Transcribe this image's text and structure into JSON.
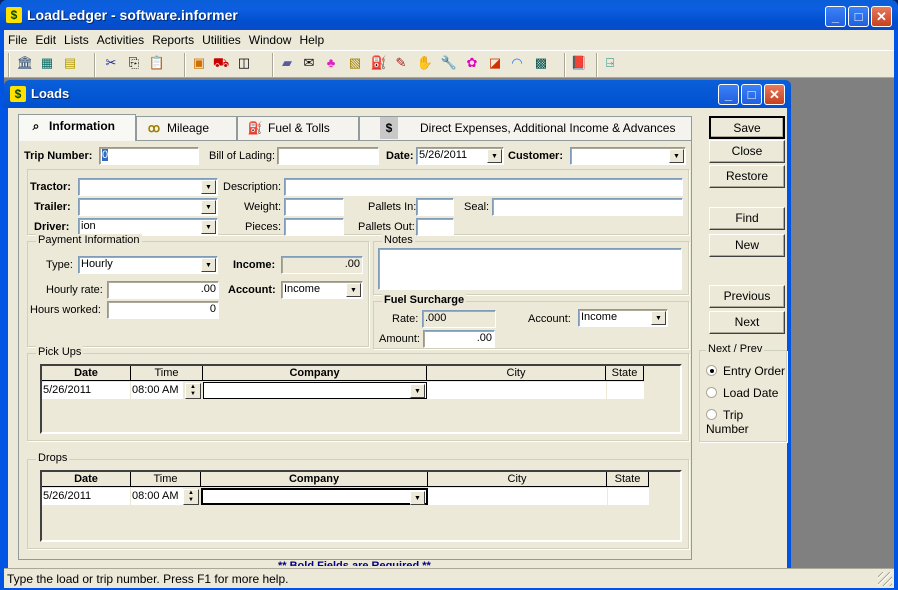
{
  "app": {
    "title": "LoadLedger - software.informer",
    "icon": "dollar-globe-icon",
    "window_buttons": {
      "minimize": "_",
      "maximize": "□",
      "close": "✕"
    }
  },
  "menu": [
    "File",
    "Edit",
    "Lists",
    "Activities",
    "Reports",
    "Utilities",
    "Window",
    "Help"
  ],
  "toolbar": {
    "icons": [
      "bank-icon",
      "register-icon",
      "clipboard-icon",
      "cut-icon",
      "copy-icon",
      "paste-icon",
      "driver-photo-icon",
      "truck-icon",
      "trailer-icon",
      "map-icon",
      "invoice-icon",
      "piggy-bank-icon",
      "checkbook-icon",
      "fuel-pump-icon",
      "pencil-icon",
      "hand-icon",
      "wrench-icon",
      "pink-key-icon",
      "card-icon",
      "rainbow-icon",
      "calculator-icon",
      "help-book-icon",
      "exit-door-icon"
    ]
  },
  "loads_window": {
    "title": "Loads",
    "tabs": [
      {
        "label": "Information",
        "icon": "magnifier-icon",
        "glyph": "⌕",
        "active": true
      },
      {
        "label": "Mileage",
        "icon": "footprints-icon",
        "glyph": "ꝏ",
        "active": false
      },
      {
        "label": "Fuel & Tolls",
        "icon": "fuel-tolls-icon",
        "glyph": "⛽",
        "active": false
      },
      {
        "label": "Direct Expenses, Additional Income & Advances",
        "icon": "dollar-icon",
        "glyph": "$",
        "active": false
      }
    ],
    "header_fields": {
      "trip_number": {
        "label": "Trip Number:",
        "value": "0"
      },
      "bill_of_lading": {
        "label": "Bill of Lading:",
        "value": ""
      },
      "date": {
        "label": "Date:",
        "value": "5/26/2011"
      },
      "customer": {
        "label": "Customer:",
        "value": ""
      }
    },
    "equipment": {
      "tractor": {
        "label": "Tractor:",
        "value": ""
      },
      "trailer": {
        "label": "Trailer:",
        "value": ""
      },
      "driver": {
        "label": "Driver:",
        "value": "ion"
      },
      "description": {
        "label": "Description:",
        "value": ""
      },
      "weight": {
        "label": "Weight:",
        "value": ""
      },
      "pieces": {
        "label": "Pieces:",
        "value": ""
      },
      "pallets_in": {
        "label": "Pallets In:",
        "value": ""
      },
      "pallets_out": {
        "label": "Pallets Out:",
        "value": ""
      },
      "seal": {
        "label": "Seal:",
        "value": ""
      }
    },
    "payment": {
      "title": "Payment Information",
      "type": {
        "label": "Type:",
        "value": "Hourly"
      },
      "income": {
        "label": "Income:",
        "value": ".00"
      },
      "hourly_rate": {
        "label": "Hourly rate:",
        "value": ".00"
      },
      "account": {
        "label": "Account:",
        "value": "Income"
      },
      "hours_worked": {
        "label": "Hours worked:",
        "value": "0"
      }
    },
    "notes": {
      "title": "Notes",
      "value": ""
    },
    "fuel_surcharge": {
      "title": "Fuel Surcharge",
      "rate": {
        "label": "Rate:",
        "value": ".000"
      },
      "account": {
        "label": "Account:",
        "value": "Income"
      },
      "amount": {
        "label": "Amount:",
        "value": ".00"
      }
    },
    "pickups": {
      "title": "Pick Ups",
      "columns": [
        "Date",
        "Time",
        "Company",
        "City",
        "State"
      ],
      "rows": [
        {
          "date": "5/26/2011",
          "time": "08:00 AM",
          "company": "",
          "city": "",
          "state": ""
        }
      ]
    },
    "drops": {
      "title": "Drops",
      "columns": [
        "Date",
        "Time",
        "Company",
        "City",
        "State"
      ],
      "rows": [
        {
          "date": "5/26/2011",
          "time": "08:00 AM",
          "company": "",
          "city": "",
          "state": ""
        }
      ]
    },
    "required_note": "** Bold Fields are Required **",
    "buttons": {
      "save": "Save",
      "close": "Close",
      "restore": "Restore",
      "find": "Find",
      "new": "New",
      "previous": "Previous",
      "next": "Next"
    },
    "next_prev": {
      "title": "Next / Prev",
      "options": [
        {
          "label": "Entry Order",
          "selected": true
        },
        {
          "label": "Load Date",
          "selected": false
        },
        {
          "label": "Trip Number",
          "selected": false
        }
      ]
    }
  },
  "status_bar": {
    "text": "Type the load or trip number. Press F1 for more help."
  }
}
